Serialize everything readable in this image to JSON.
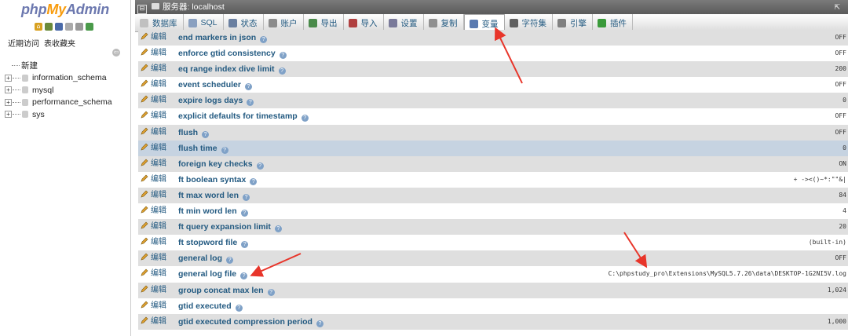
{
  "nav": {
    "logo": {
      "php": "php",
      "my": "My",
      "admin": "Admin"
    },
    "links": [
      "近期访问",
      "表收藏夹"
    ],
    "new_label": "新建",
    "databases": [
      "information_schema",
      "mysql",
      "performance_schema",
      "sys"
    ]
  },
  "server": {
    "label": "服务器: localhost",
    "collapse_symbol": "⊟",
    "right_glyph": "⇱"
  },
  "tabs": [
    {
      "label": "数据库",
      "icon_color": "#c0c0c0"
    },
    {
      "label": "SQL",
      "icon_color": "#8aa0c0"
    },
    {
      "label": "状态",
      "icon_color": "#6a7fa0"
    },
    {
      "label": "账户",
      "icon_color": "#8c8c8c"
    },
    {
      "label": "导出",
      "icon_color": "#4a8a4a"
    },
    {
      "label": "导入",
      "icon_color": "#b04040"
    },
    {
      "label": "设置",
      "icon_color": "#7a7a9a"
    },
    {
      "label": "复制",
      "icon_color": "#909090"
    },
    {
      "label": "变量",
      "icon_color": "#5a7ab0",
      "active": true
    },
    {
      "label": "字符集",
      "icon_color": "#606060"
    },
    {
      "label": "引擎",
      "icon_color": "#808080"
    },
    {
      "label": "插件",
      "icon_color": "#3a9a3a"
    }
  ],
  "edit_label": "编辑",
  "help_symbol": "?",
  "variables": [
    {
      "name": "end markers in json",
      "value": "OFF"
    },
    {
      "name": "enforce gtid consistency",
      "value": "OFF"
    },
    {
      "name": "eq range index dive limit",
      "value": "200"
    },
    {
      "name": "event scheduler",
      "value": "OFF"
    },
    {
      "name": "expire logs days",
      "value": "0"
    },
    {
      "name": "explicit defaults for timestamp",
      "value": "OFF"
    },
    {
      "name": "flush",
      "value": "OFF"
    },
    {
      "name": "flush time",
      "value": "0"
    },
    {
      "name": "foreign key checks",
      "value": "ON"
    },
    {
      "name": "ft boolean syntax",
      "value": "+ -><()~*:\"\"&|"
    },
    {
      "name": "ft max word len",
      "value": "84"
    },
    {
      "name": "ft min word len",
      "value": "4"
    },
    {
      "name": "ft query expansion limit",
      "value": "20"
    },
    {
      "name": "ft stopword file",
      "value": "(built-in)"
    },
    {
      "name": "general log",
      "value": "OFF"
    },
    {
      "name": "general log file",
      "value": "C:\\phpstudy_pro\\Extensions\\MySQL5.7.26\\data\\DESKTOP-1G2NI5V.log"
    },
    {
      "name": "group concat max len",
      "value": "1,024"
    },
    {
      "name": "gtid executed",
      "value": ""
    },
    {
      "name": "gtid executed compression period",
      "value": "1,000"
    }
  ],
  "highlight_row": 7,
  "colors": {
    "link": "#235a81",
    "arrow": "#e8352a",
    "row_alt": "#dfdfdf",
    "row_highlight": "#c6d3e1"
  }
}
